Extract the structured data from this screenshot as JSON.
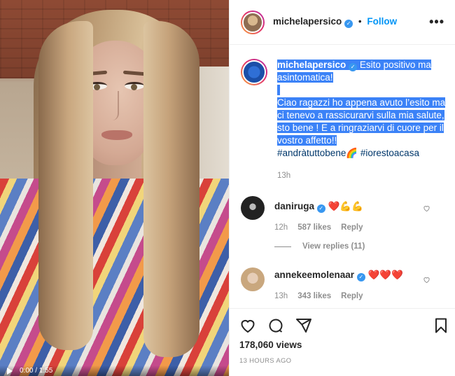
{
  "post_media": {
    "alt": "Woman with long blonde hair wearing a colorful striped top",
    "video_time": "0:00 / 1:55"
  },
  "header": {
    "username": "michelapersico",
    "separator": "•",
    "follow_label": "Follow",
    "more_icon": "more-horizontal-icon"
  },
  "caption": {
    "username": "michelapersico",
    "title_text": "Esito positivo ma asintomatica!",
    "body_text": "Ciao ragazzi ho appena avuto l’esito ma ci tenevo a rassicurarvi sulla mia salute, sto bene ! E a ringraziarvi di cuore per il vostro affetto!!",
    "hashtags": "#andràtuttobene🌈 #iorestoacasa",
    "time": "13h"
  },
  "comments": [
    {
      "username": "daniruga",
      "text": "❤️💪💪",
      "time": "12h",
      "likes": "587 likes",
      "reply_label": "Reply"
    },
    {
      "username": "annekeemolenaar",
      "text": "❤️❤️❤️",
      "time": "13h",
      "likes": "343 likes",
      "reply_label": "Reply"
    }
  ],
  "view_replies": "View replies (11)",
  "footer": {
    "views": "178,060 views",
    "timestamp": "13 HOURS AGO"
  },
  "colors": {
    "accent": "#0095f6",
    "selection": "#3b82f7",
    "verified": "#3897f0",
    "muted": "#8e8e8e"
  }
}
